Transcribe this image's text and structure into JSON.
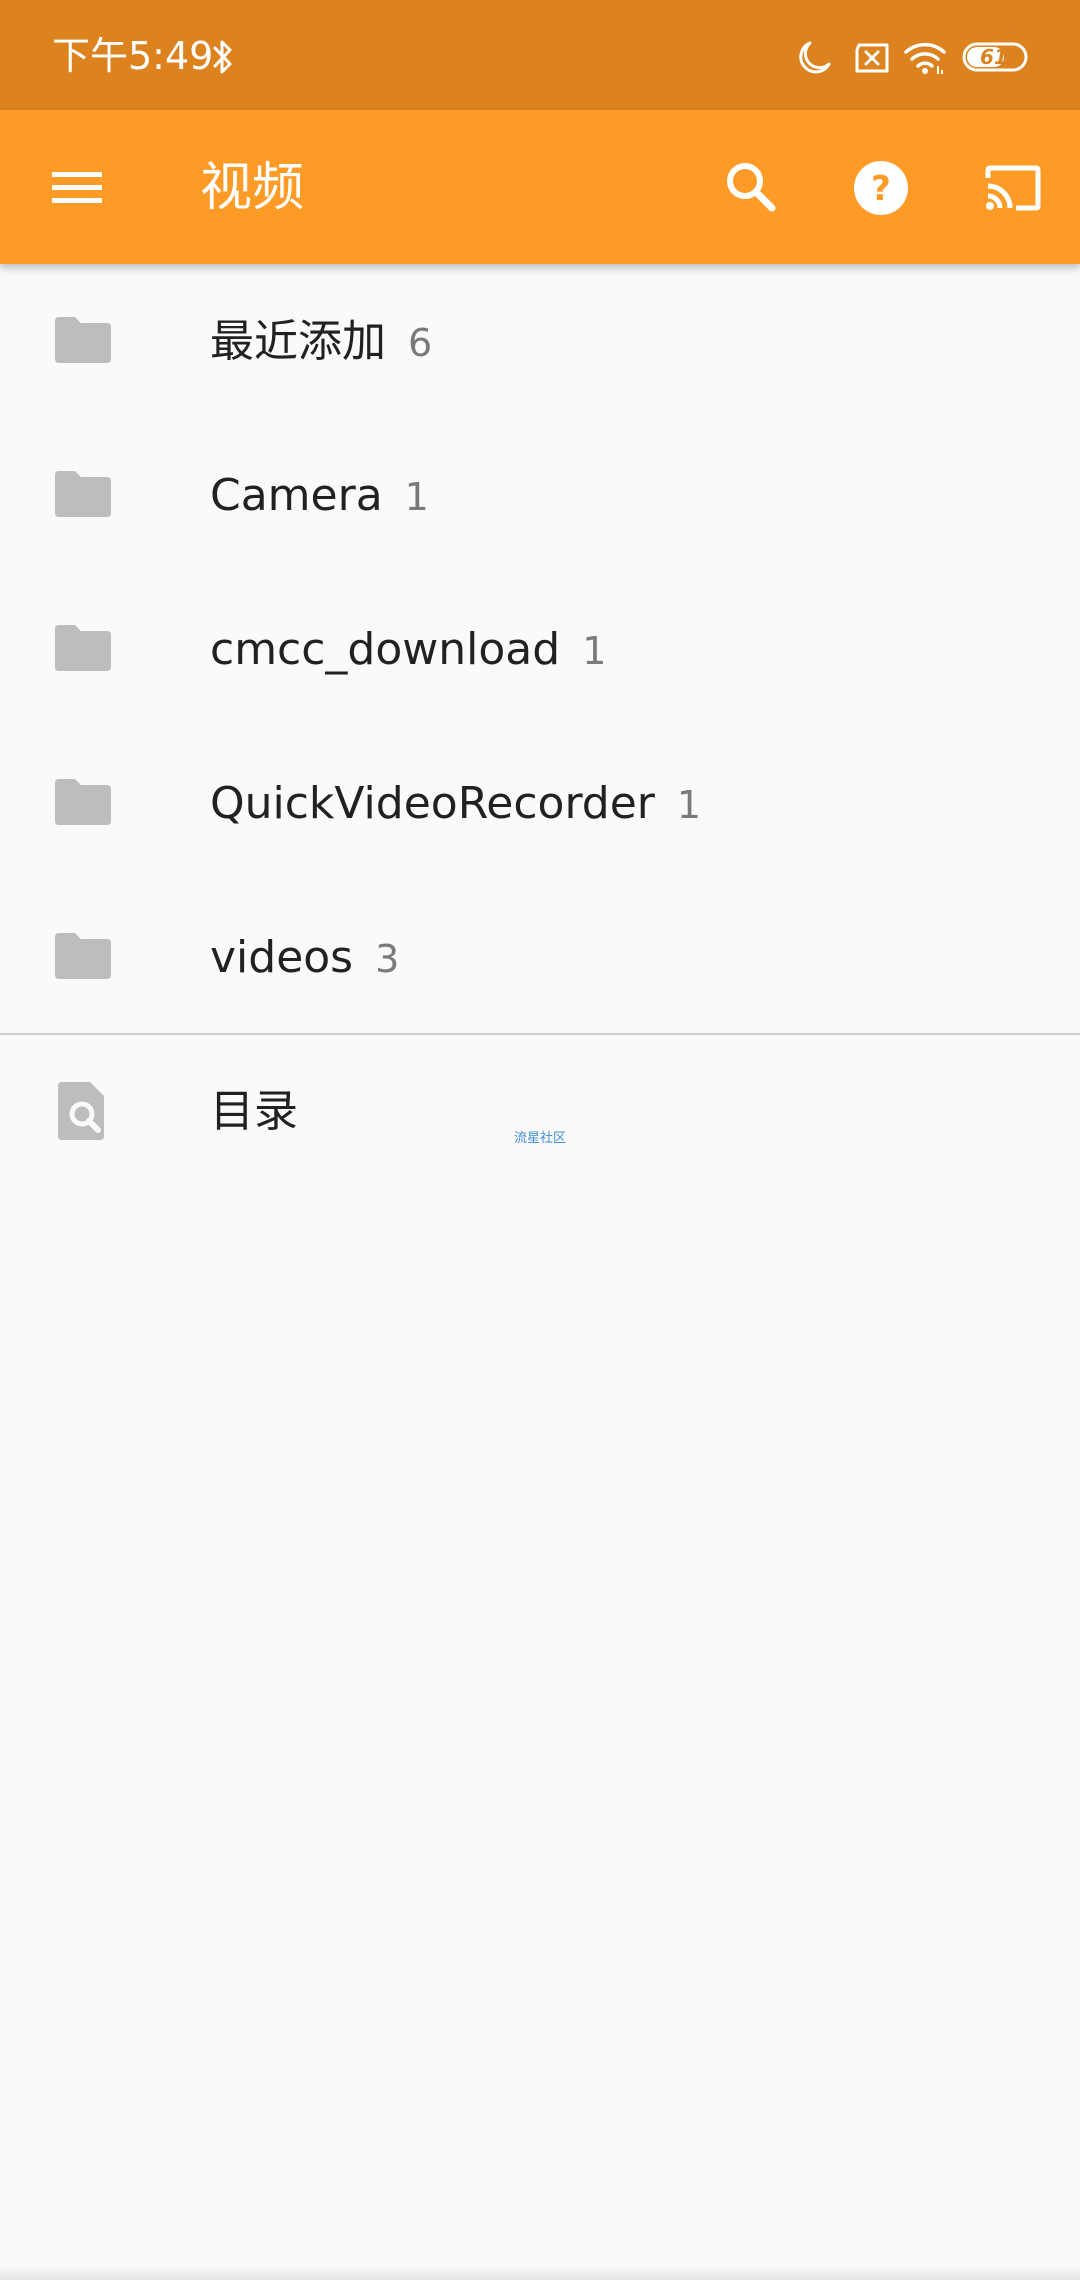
{
  "status_bar": {
    "time": "下午5:49",
    "battery_level": "61",
    "icons": [
      "bluetooth-icon",
      "moon-icon",
      "sim-blocked-icon",
      "wifi-icon",
      "battery-icon"
    ]
  },
  "app_bar": {
    "title": "视频",
    "icons": [
      "menu-icon",
      "search-icon",
      "help-icon",
      "cast-icon"
    ]
  },
  "folders": [
    {
      "label": "最近添加",
      "count": "6"
    },
    {
      "label": "Camera",
      "count": "1"
    },
    {
      "label": "cmcc_download",
      "count": "1"
    },
    {
      "label": "QuickVideoRecorder",
      "count": "1"
    },
    {
      "label": "videos",
      "count": "3"
    }
  ],
  "directory": {
    "label": "目录",
    "icon": "file-search-icon"
  },
  "watermark": "流星社区",
  "colors": {
    "status_bar": "#dc831f",
    "app_bar": "#fe9b27",
    "background": "#fafafa",
    "folder_icon": "#bdbdbd",
    "primary_text": "#212121",
    "secondary_text": "#7a7a7a"
  }
}
